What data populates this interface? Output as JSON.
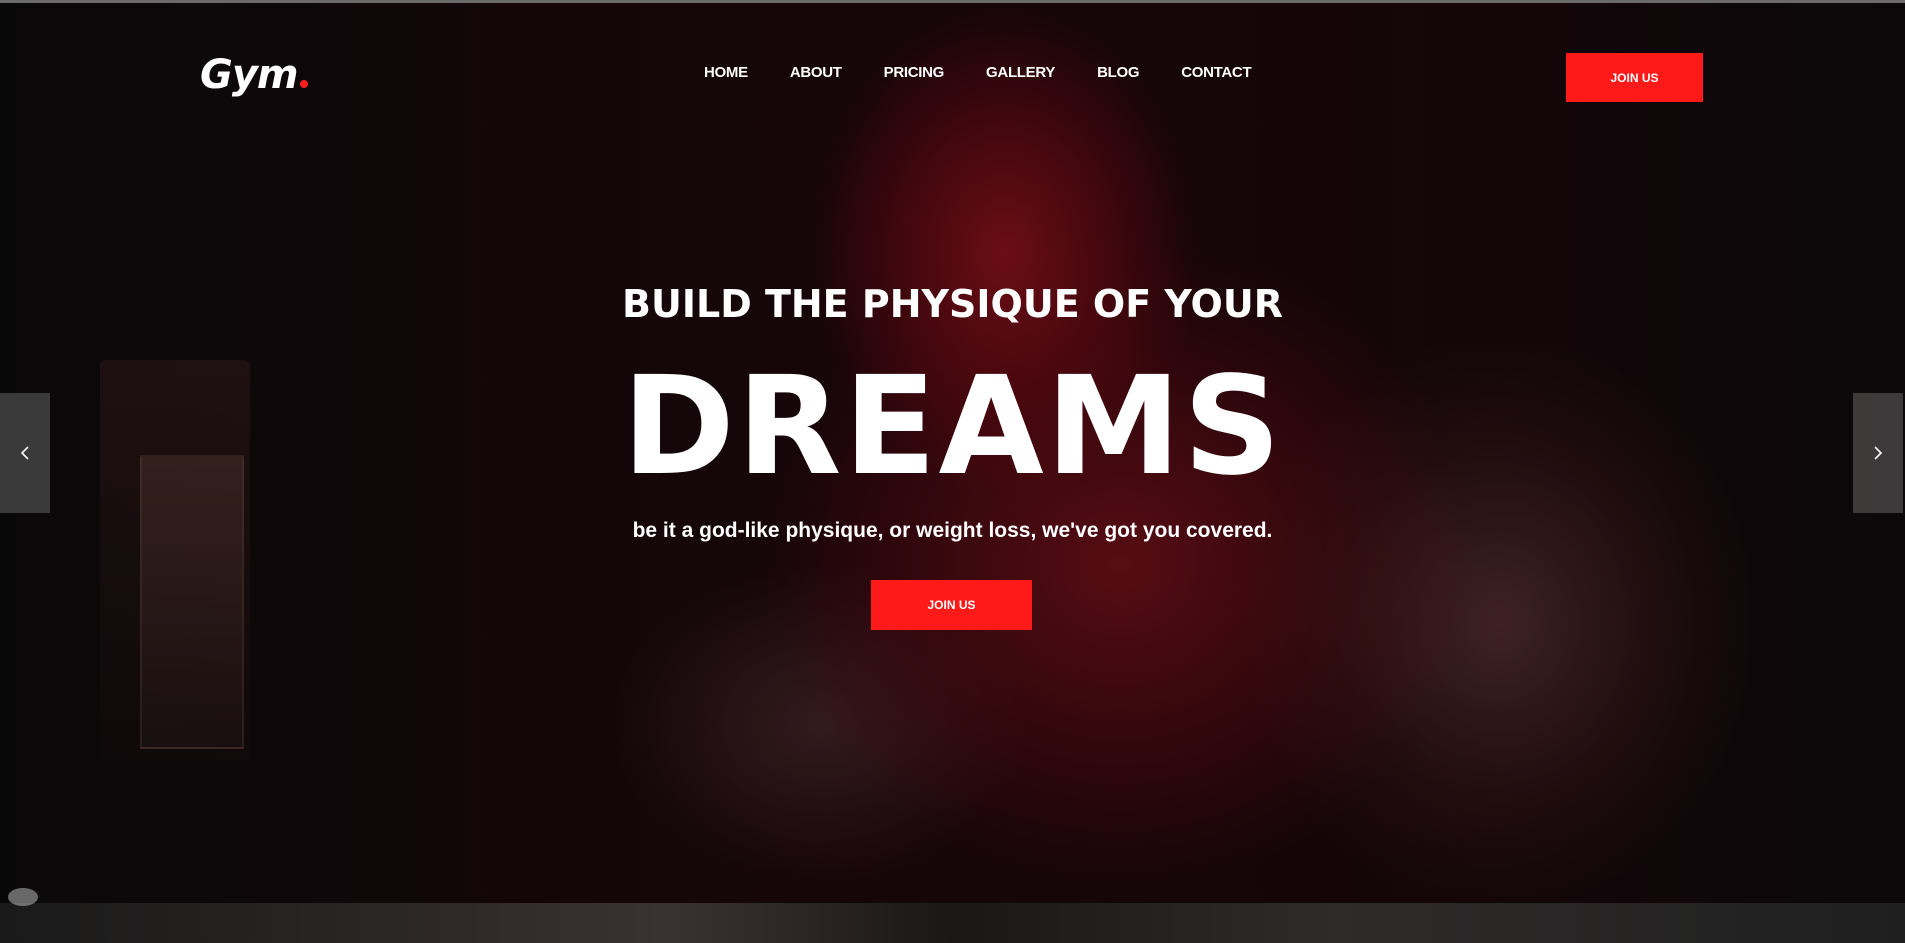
{
  "header": {
    "logo_text": "Gym",
    "nav_items": [
      {
        "label": "HOME"
      },
      {
        "label": "ABOUT"
      },
      {
        "label": "PRICING"
      },
      {
        "label": "GALLERY"
      },
      {
        "label": "BLOG"
      },
      {
        "label": "CONTACT"
      }
    ],
    "join_label": "JOIN US"
  },
  "hero": {
    "subtitle": "BUILD THE PHYSIQUE OF YOUR",
    "title": "DREAMS",
    "description": "be it a god-like physique, or weight loss, we've got you covered.",
    "join_label": "JOIN US",
    "prev_icon": "chevron-left-icon",
    "next_icon": "chevron-right-icon"
  },
  "colors": {
    "accent": "#ff1a1a",
    "text": "#ffffff"
  }
}
